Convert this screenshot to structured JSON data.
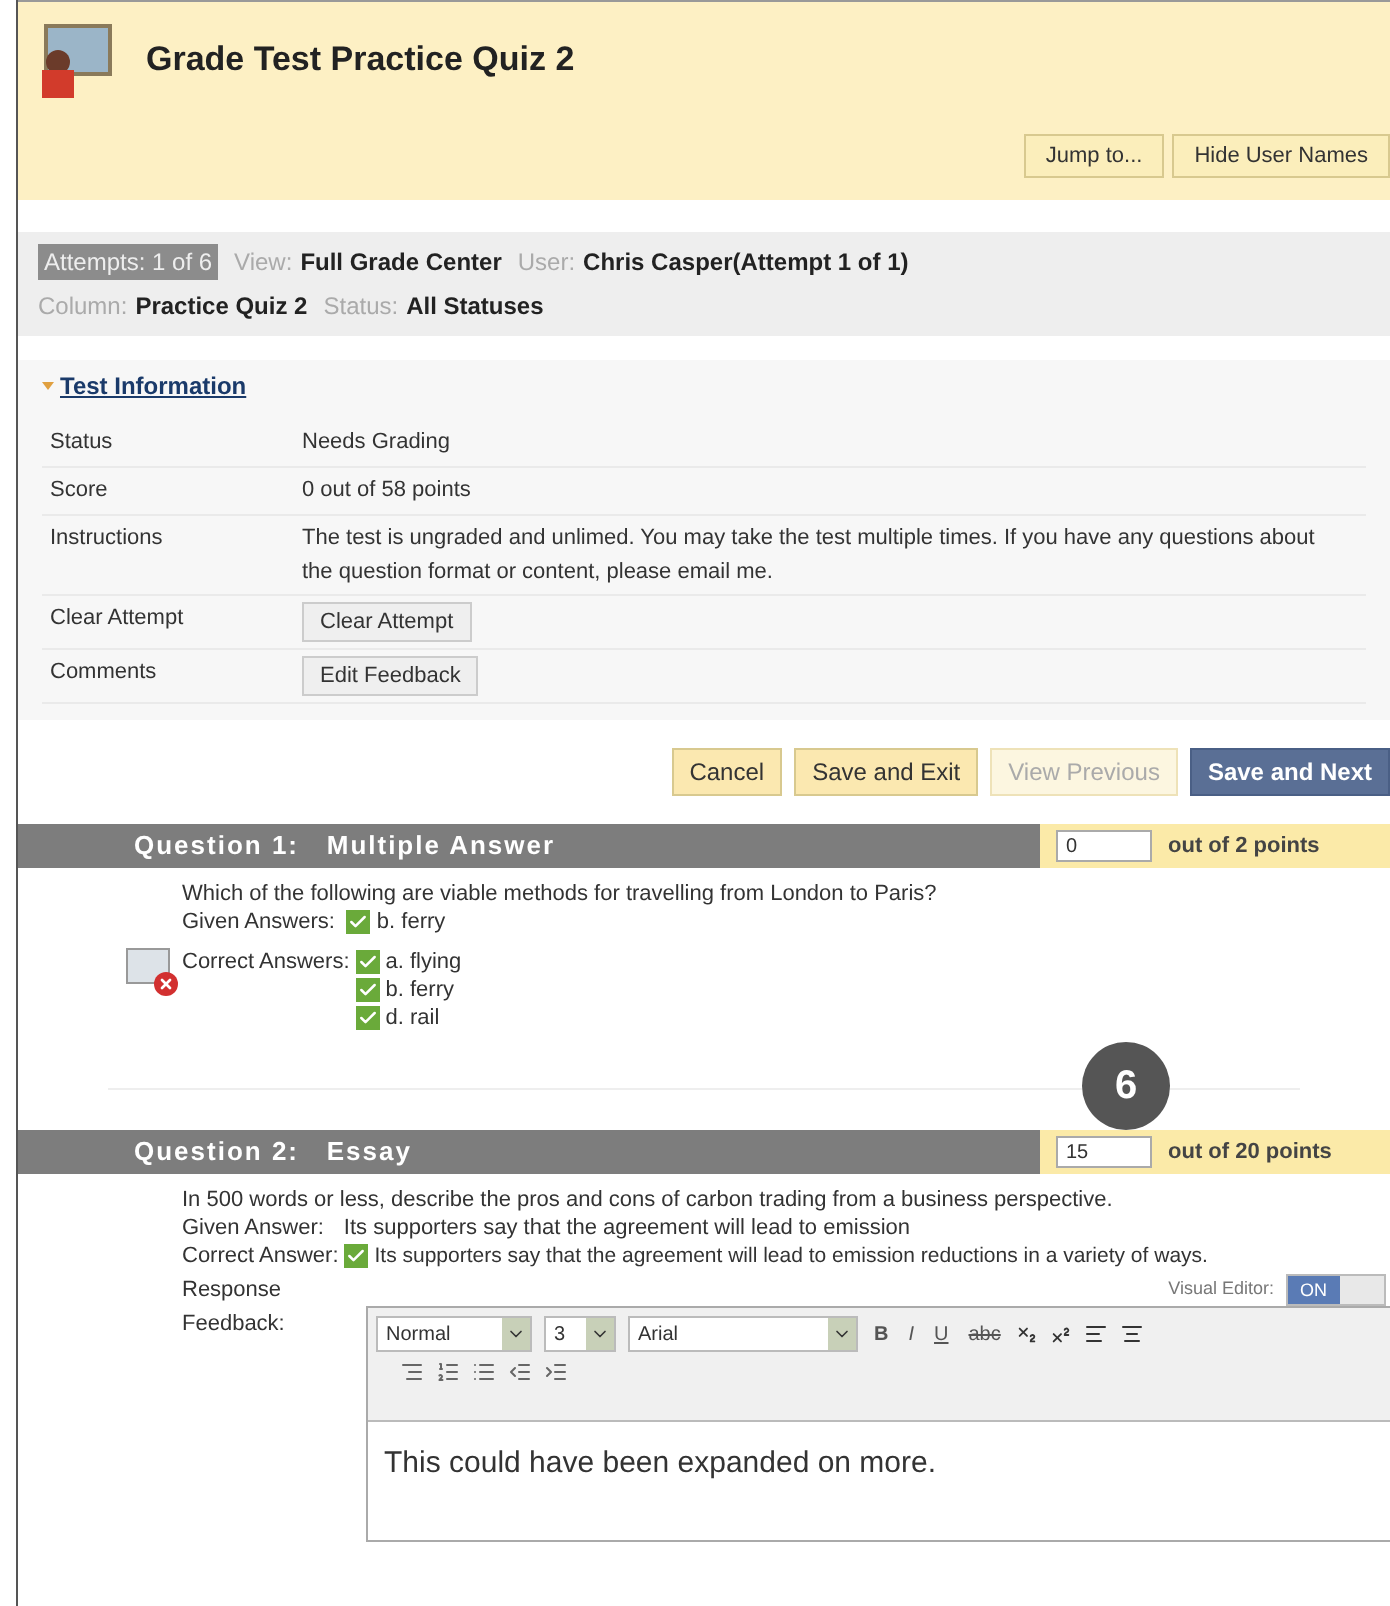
{
  "header": {
    "title": "Grade Test Practice Quiz 2",
    "buttons": [
      "Jump to...",
      "Hide User Names"
    ]
  },
  "info_bar": {
    "attempts": "Attempts: 1 of 6",
    "line1": [
      {
        "label": "View:",
        "value": "Full Grade Center"
      },
      {
        "label": "User:",
        "value": "Chris Casper(Attempt 1 of 1)"
      }
    ],
    "line2": [
      {
        "label": "Column:",
        "value": "Practice Quiz 2"
      },
      {
        "label": "Status:",
        "value": "All Statuses"
      }
    ]
  },
  "test_information": {
    "title": "Test Information",
    "expanded": true,
    "rows": [
      {
        "label": "Status",
        "kind": "text",
        "value": "Needs Grading"
      },
      {
        "label": "Score",
        "kind": "text",
        "value": "0 out of 58 points"
      },
      {
        "label": "Instructions",
        "kind": "text",
        "value": "The test is ungraded and unlimed. You may take the test multiple times. If you have any questions about the question format or content, please email me."
      },
      {
        "label": "Clear Attempt",
        "kind": "button",
        "value": "Clear Attempt"
      },
      {
        "label": "Comments",
        "kind": "button",
        "value": "Edit Feedback"
      }
    ]
  },
  "actions": [
    {
      "label": "Cancel",
      "kind": "normal",
      "disabled": false
    },
    {
      "label": "Save and Exit",
      "kind": "normal",
      "disabled": false
    },
    {
      "label": "View Previous",
      "kind": "normal",
      "disabled": true
    },
    {
      "label": "Save and Next",
      "kind": "primary",
      "disabled": false
    }
  ],
  "question_1": {
    "title": "Question 1:",
    "type": "Multiple Answer",
    "score": "0",
    "out_of": "out of 2 points",
    "prompt": "Which of the following are viable methods for travelling from London to Paris?",
    "given_label": "Given Answers:",
    "given": [
      {
        "text": "b.  ferry",
        "checked": true
      }
    ],
    "correct_label": "Correct Answers:",
    "correct": [
      {
        "text": "a.  flying",
        "checked": true
      },
      {
        "text": "b.  ferry",
        "checked": true
      },
      {
        "text": "d.  rail",
        "checked": true
      }
    ]
  },
  "callout": "6",
  "question_2": {
    "title": "Question 2:",
    "type": "Essay",
    "score": "15",
    "out_of": "out of 20 points",
    "prompt": "In 500 words or less, describe the pros and cons of carbon trading from a business perspective.",
    "given_label": "Given Answer:",
    "given": "Its supporters say that the agreement will lead to emission",
    "correct_label": "Correct Answer:",
    "correct": "Its supporters say that the agreement will lead to emission reductions in a variety of ways.",
    "correct_checked": true,
    "feedback_label": "Response Feedback:",
    "visual_editor": {
      "label": "Visual Editor:",
      "state": "ON",
      "on": true
    },
    "toolbar": {
      "selects": [
        "Normal",
        "3",
        "Arial"
      ],
      "styles": [
        "B",
        "I",
        "U",
        "abc"
      ]
    },
    "feedback_text": "This could have been expanded on more."
  }
}
